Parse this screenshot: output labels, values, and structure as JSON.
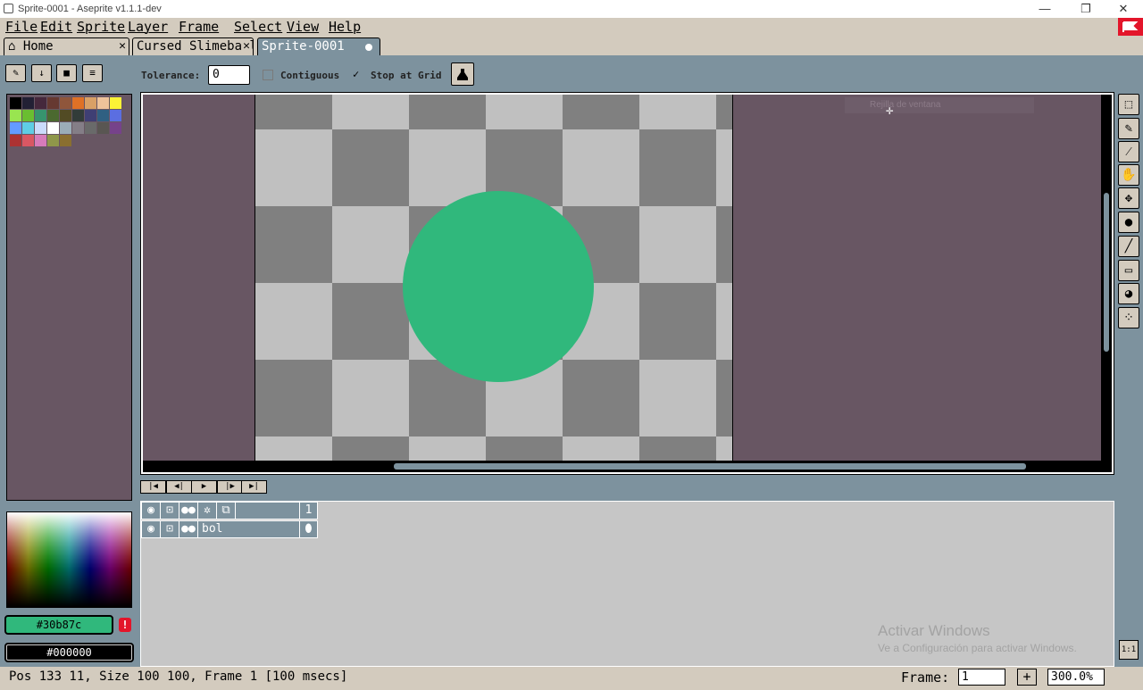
{
  "window": {
    "title": "Sprite-0001 - Aseprite v1.1.1-dev",
    "minimize": "—",
    "restore": "❐",
    "close": "✕"
  },
  "menu": [
    "File",
    "Edit",
    "Sprite",
    "Layer",
    "Frame",
    "Select",
    "View",
    "Help"
  ],
  "tabs": [
    {
      "label": "Home",
      "close": "✕"
    },
    {
      "label": "Cursed Slimeball",
      "close": "✕"
    },
    {
      "label": "Sprite-0001"
    }
  ],
  "context": {
    "tolerance_label": "Tolerance:",
    "tolerance_value": "0",
    "contiguous_label": "Contiguous",
    "contiguous_checked": false,
    "stop_at_grid_label": "Stop at Grid",
    "stop_at_grid_checked": true
  },
  "palette": [
    "#000000",
    "#222034",
    "#45283c",
    "#663931",
    "#8f563b",
    "#df7126",
    "#d9a066",
    "#eec39a",
    "#fbf236",
    "#99e550",
    "#6abe30",
    "#37946e",
    "#4b692f",
    "#524b24",
    "#323c39",
    "#3f3f74",
    "#306082",
    "#5b6ee1",
    "#639bff",
    "#5fcde4",
    "#cbdbfc",
    "#ffffff",
    "#9badb7",
    "#847e87",
    "#696a6a",
    "#595652",
    "#76428a",
    "#ac3232",
    "#d95763",
    "#d77bba",
    "#8f974a",
    "#8a6f30"
  ],
  "colors": {
    "foreground": "#30b87c",
    "background": "#000000",
    "warning": "!"
  },
  "editor": {
    "tooltip": "Rejilla de ventana"
  },
  "timeline": {
    "frame_number": "1",
    "layer_name": "bol"
  },
  "watermark": {
    "line1": "Activar Windows",
    "line2": "Ve a Configuración para activar Windows."
  },
  "status": {
    "text": "Pos 133 11, Size 100 100, Frame 1 [100 msecs]",
    "frame_label": "Frame:",
    "frame_value": "1",
    "frame_add": "+",
    "zoom": "300.0%"
  },
  "zoom_button": "1:1"
}
